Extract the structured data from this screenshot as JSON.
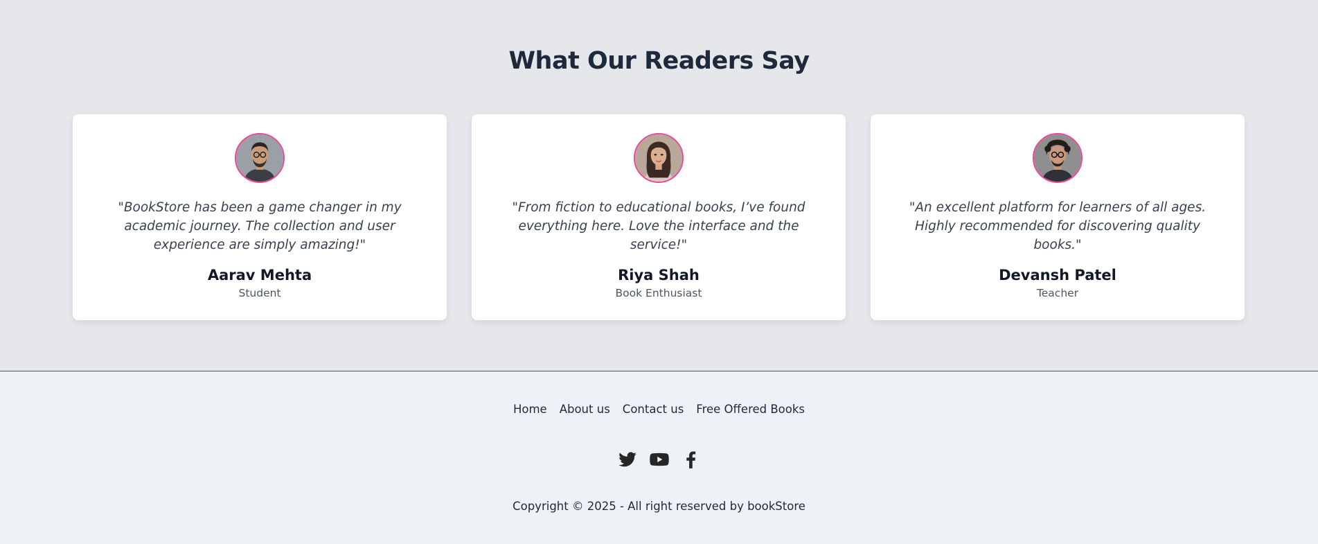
{
  "testimonials": {
    "title": "What Our Readers Say",
    "items": [
      {
        "quote": "\"BookStore has been a game changer in my academic journey. The collection and user experience are simply amazing!\"",
        "name": "Aarav Mehta",
        "role": "Student"
      },
      {
        "quote": "\"From fiction to educational books, I’ve found everything here. Love the interface and the service!\"",
        "name": "Riya Shah",
        "role": "Book Enthusiast"
      },
      {
        "quote": "\"An excellent platform for learners of all ages. Highly recommended for discovering quality books.\"",
        "name": "Devansh Patel",
        "role": "Teacher"
      }
    ]
  },
  "footer": {
    "links": [
      "Home",
      "About us",
      "Contact us",
      "Free Offered Books"
    ],
    "socials": [
      "twitter-icon",
      "youtube-icon",
      "facebook-icon"
    ],
    "copyright": "Copyright © 2025 - All right reserved by bookStore"
  },
  "colors": {
    "accent_border": "#ec4899",
    "section_bg": "#e5e7eb",
    "footer_bg": "#eef2f7"
  }
}
